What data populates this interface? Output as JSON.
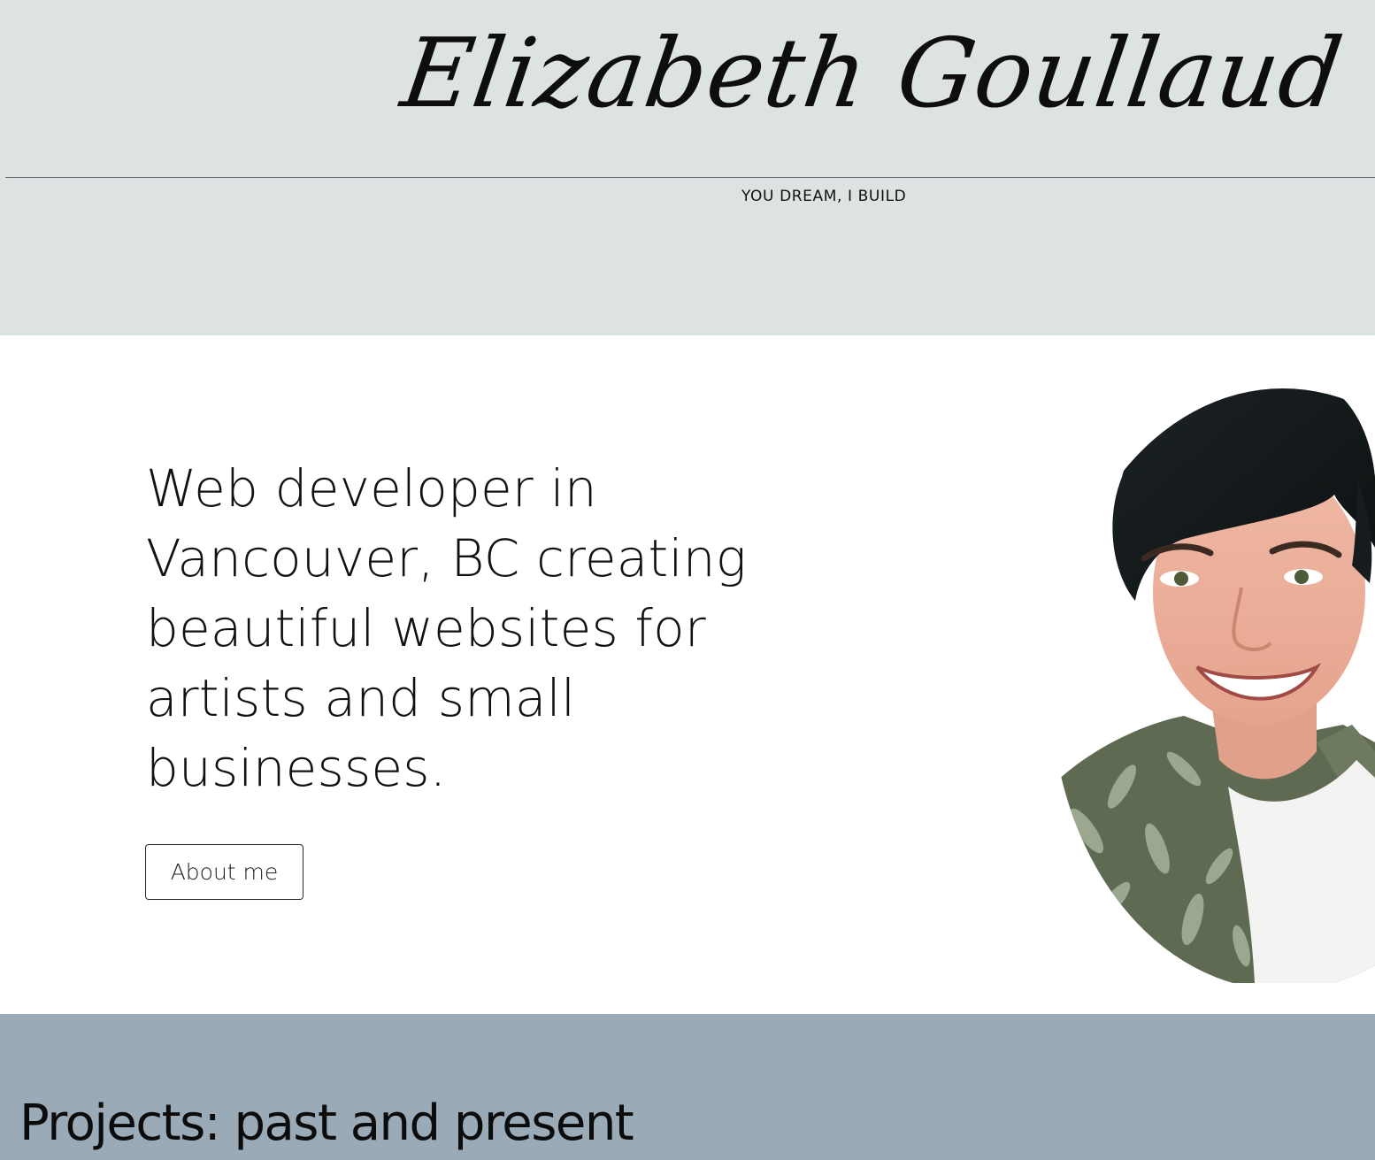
{
  "header": {
    "logo_text": "Elizabeth Goullaud",
    "tagline": "YOU DREAM, I BUILD"
  },
  "hero": {
    "headline": "Web developer in Vancouver, BC creating beautiful websites for artists and small businesses.",
    "about_button_label": "About me",
    "portrait": "portrait-photo"
  },
  "projects": {
    "title": "Projects: past and present"
  },
  "colors": {
    "header_bg": "#dde2e3",
    "hero_bg": "#ffffff",
    "projects_bg": "#9aabb7",
    "text": "#111111"
  }
}
